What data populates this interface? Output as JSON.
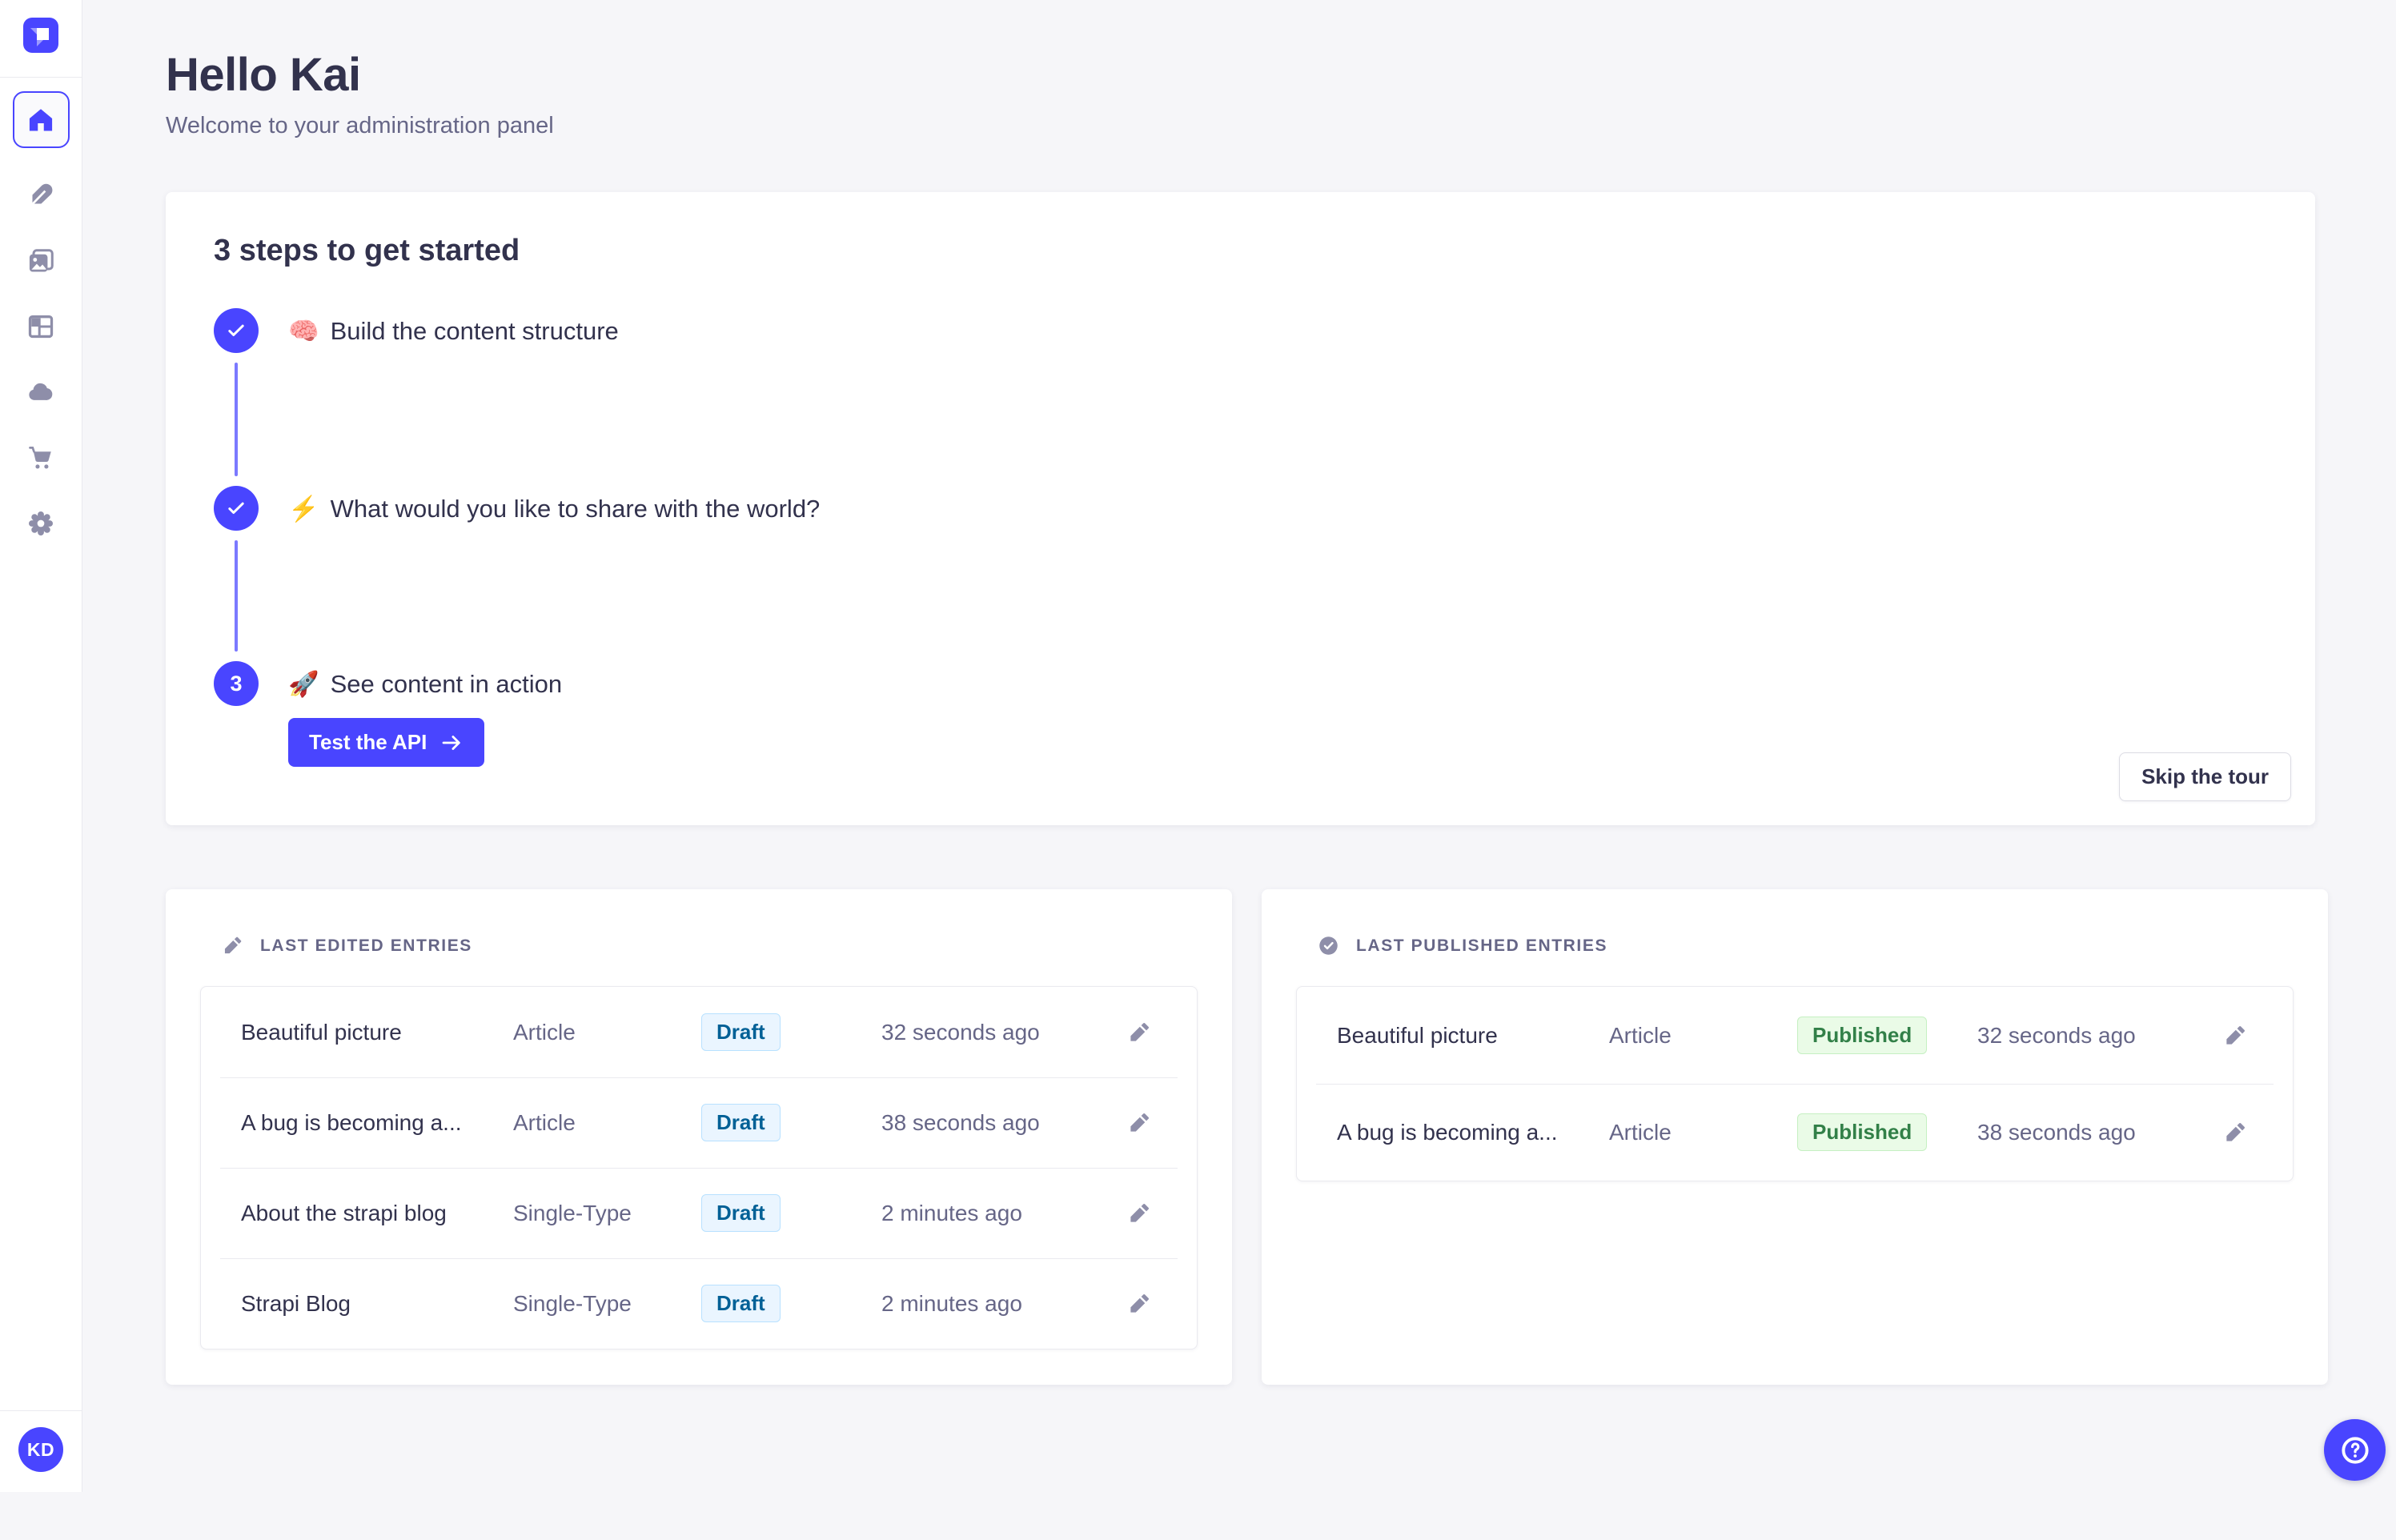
{
  "colors": {
    "accent": "#4945ff",
    "accent_light": "#7b79ff",
    "page_bg": "#f6f6f9",
    "border": "#eaeaef",
    "heading": "#32324d",
    "muted": "#666687",
    "icon_gray": "#8e8ea9",
    "draft_bg": "#eaf5ff",
    "draft_border": "#b8e1ff",
    "draft_text": "#006096",
    "published_bg": "#eafbe7",
    "published_border": "#c6f0c2",
    "published_text": "#328048"
  },
  "sidebar": {
    "logo_icon": "strapi-logo",
    "items": [
      {
        "icon": "home-icon",
        "active": true
      },
      {
        "icon": "feather-icon",
        "active": false
      },
      {
        "icon": "media-library-icon",
        "active": false
      },
      {
        "icon": "layout-icon",
        "active": false
      },
      {
        "icon": "cloud-icon",
        "active": false
      },
      {
        "icon": "cart-icon",
        "active": false
      },
      {
        "icon": "gear-icon",
        "active": false
      }
    ],
    "avatar_initials": "KD"
  },
  "header": {
    "title": "Hello Kai",
    "subtitle": "Welcome to your administration panel"
  },
  "onboarding": {
    "title": "3 steps to get started",
    "steps": [
      {
        "state": "completed",
        "icon": "check-icon",
        "emoji": "🧠",
        "label": "Build the content structure"
      },
      {
        "state": "completed",
        "icon": "check-icon",
        "emoji": "⚡",
        "label": "What would you like to share with the world?"
      },
      {
        "state": "active",
        "number": "3",
        "emoji": "🚀",
        "label": "See content in action"
      }
    ],
    "test_api_button": "Test the API",
    "test_api_icon": "arrow-right-icon",
    "skip_button": "Skip the tour"
  },
  "entries": {
    "edited": {
      "title": "LAST EDITED ENTRIES",
      "header_icon": "pencil-icon",
      "rows": [
        {
          "name": "Beautiful picture",
          "type": "Article",
          "status": "Draft",
          "time": "32 seconds ago"
        },
        {
          "name": "A bug is becoming a...",
          "type": "Article",
          "status": "Draft",
          "time": "38 seconds ago"
        },
        {
          "name": "About the strapi blog",
          "type": "Single-Type",
          "status": "Draft",
          "time": "2 minutes ago"
        },
        {
          "name": "Strapi Blog",
          "type": "Single-Type",
          "status": "Draft",
          "time": "2 minutes ago"
        }
      ]
    },
    "published": {
      "title": "LAST PUBLISHED ENTRIES",
      "header_icon": "check-circle-icon",
      "rows": [
        {
          "name": "Beautiful picture",
          "type": "Article",
          "status": "Published",
          "time": "32 seconds ago"
        },
        {
          "name": "A bug is becoming a...",
          "type": "Article",
          "status": "Published",
          "time": "38 seconds ago"
        }
      ]
    }
  },
  "help": {
    "icon": "question-circle-icon"
  }
}
